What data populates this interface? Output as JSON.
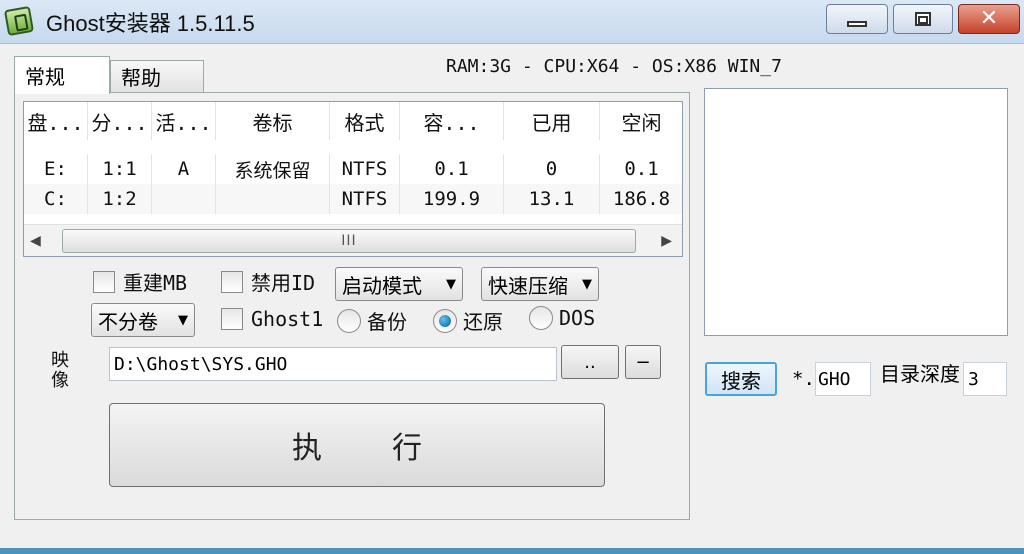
{
  "window": {
    "title": "Ghost安装器 1.5.11.5",
    "close_symbol": "✕"
  },
  "sysinfo": "RAM:3G - CPU:X64 - OS:X86 WIN_7",
  "tabs": [
    {
      "label": "常规"
    },
    {
      "label": "帮助"
    }
  ],
  "partition_table": {
    "columns": [
      "盘...",
      "分...",
      "活...",
      "卷标",
      "格式",
      "容...",
      "已用",
      "空闲"
    ],
    "rows": [
      [
        "E:",
        "1:1",
        "A",
        "系统保留",
        "NTFS",
        "0.1",
        "0",
        "0.1"
      ],
      [
        "C:",
        "1:2",
        "",
        "",
        "NTFS",
        "199.9",
        "13.1",
        "186.8"
      ]
    ],
    "scroll_grip": "III"
  },
  "options": {
    "rebuild_mbr": {
      "label": "重建MB",
      "checked": false
    },
    "disable_id": {
      "label": "禁用ID",
      "checked": false
    },
    "ghost1": {
      "label": "Ghost1",
      "checked": false
    },
    "boot_mode": "启动模式",
    "compression": "快速压缩",
    "no_split": "不分卷",
    "modes": [
      {
        "label": "备份",
        "selected": false
      },
      {
        "label": "还原",
        "selected": true
      },
      {
        "label": "DOS",
        "selected": false
      }
    ]
  },
  "image": {
    "label": "映像",
    "path": "D:\\Ghost\\SYS.GHO",
    "browse_label": "..",
    "minus_label": "−"
  },
  "execute_label": "执行",
  "search": {
    "button_label": "搜索",
    "ext_prefix": "*.",
    "ext_value": "GHO",
    "depth_label": "目录深度",
    "depth_value": "3"
  },
  "colors": {
    "accent": "#4aa3df",
    "close": "#c5422a",
    "radio": "#0b5f99"
  }
}
